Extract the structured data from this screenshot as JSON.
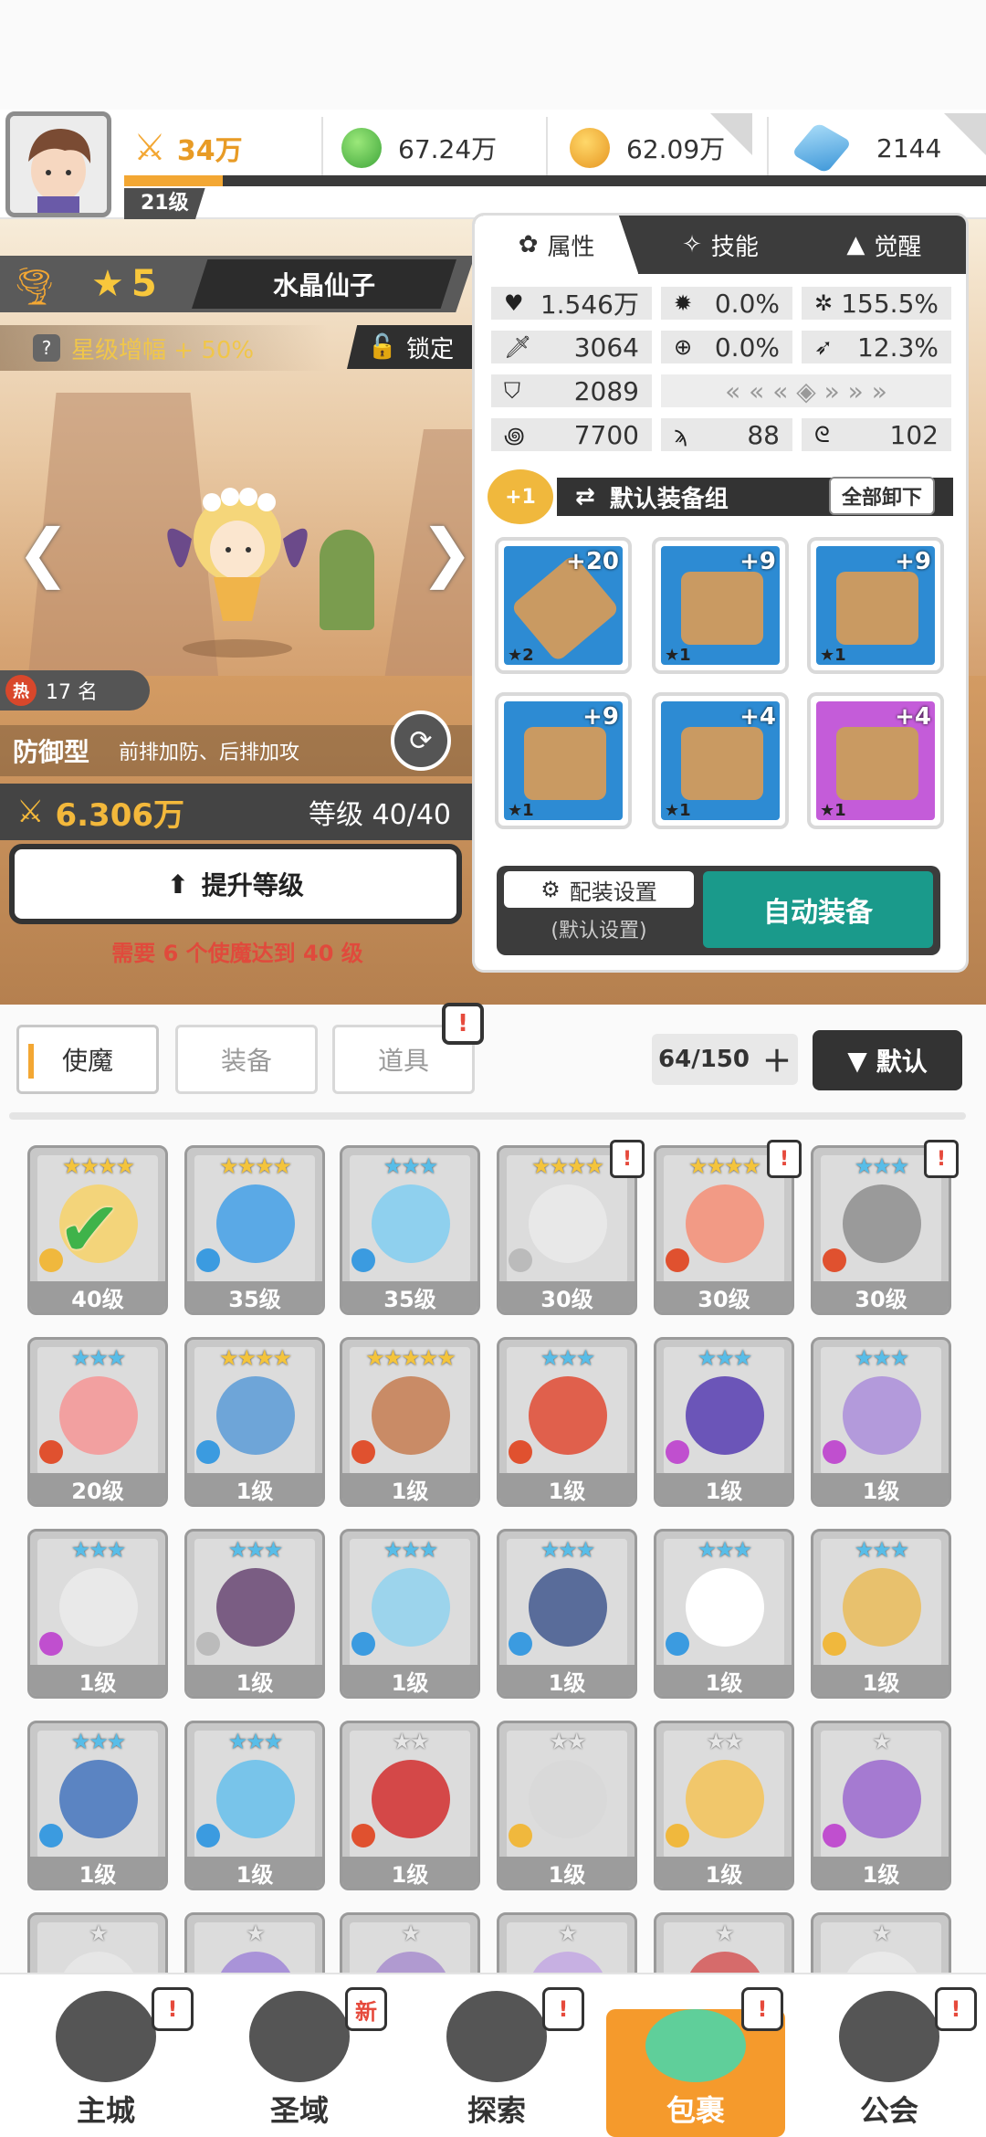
{
  "player": {
    "level": "21级",
    "power": "34万",
    "res_green": "67.24万",
    "res_gold": "62.09万",
    "res_gem": "2144"
  },
  "hero": {
    "stars": "5",
    "name": "水晶仙子",
    "boost": "星级增幅 + 50%",
    "lock": "锁定",
    "rank": "17 名",
    "hot": "热",
    "role": "防御型",
    "role_desc": "前排加防、后排加攻",
    "power": "6.306万",
    "level": "等级 40/40",
    "upgrade": "提升等级",
    "requirement": "需要 6 个使魔达到 40 级"
  },
  "panel": {
    "tabs": [
      "属性",
      "技能",
      "觉醒"
    ],
    "stats": {
      "hp": "1.546万",
      "crit": "0.0%",
      "crit_dmg": "155.5%",
      "atk": "3064",
      "acc": "0.0%",
      "speed_pct": "12.3%",
      "def": "2089",
      "s1": "7700",
      "s2": "88",
      "s3": "102"
    },
    "equip_group": "默认装备组",
    "plus_one": "+1",
    "unequip_all": "全部卸下",
    "equips": [
      {
        "plus": "+20",
        "star": "★2",
        "color": "blue",
        "icon": "sword-icon"
      },
      {
        "plus": "+9",
        "star": "★1",
        "color": "blue",
        "icon": "helmet-icon"
      },
      {
        "plus": "+9",
        "star": "★1",
        "color": "blue",
        "icon": "armor-icon"
      },
      {
        "plus": "+9",
        "star": "★1",
        "color": "blue",
        "icon": "belt-icon"
      },
      {
        "plus": "+4",
        "star": "★1",
        "color": "blue",
        "icon": "necklace-icon"
      },
      {
        "plus": "+4",
        "star": "★1",
        "color": "purple",
        "icon": "boots-icon"
      }
    ],
    "config": "配装设置",
    "config_sub": "(默认设置)",
    "auto_equip": "自动装备"
  },
  "bag": {
    "tabs": [
      "使魔",
      "装备",
      "道具"
    ],
    "count": "64/150",
    "sort": "默认",
    "alert": "!",
    "cards": [
      {
        "stars": "★★★★",
        "tier": "gold",
        "lvl": "40级",
        "elem": "#f0b83d",
        "alert": false,
        "check": true,
        "face": "#f3d47a"
      },
      {
        "stars": "★★★★",
        "tier": "gold",
        "lvl": "35级",
        "elem": "#3b9be0",
        "alert": false,
        "check": false,
        "face": "#5aa9e6"
      },
      {
        "stars": "★★★",
        "tier": "blue",
        "lvl": "35级",
        "elem": "#3b9be0",
        "alert": false,
        "check": false,
        "face": "#8fd0ee"
      },
      {
        "stars": "★★★★",
        "tier": "gold",
        "lvl": "30级",
        "elem": "#bbbbbb",
        "alert": true,
        "check": false,
        "face": "#e8e8e8"
      },
      {
        "stars": "★★★★",
        "tier": "gold",
        "lvl": "30级",
        "elem": "#e0512f",
        "alert": true,
        "check": false,
        "face": "#f29a85"
      },
      {
        "stars": "★★★",
        "tier": "blue",
        "lvl": "30级",
        "elem": "#e0512f",
        "alert": true,
        "check": false,
        "face": "#9a9a9a"
      },
      {
        "stars": "★★★",
        "tier": "blue",
        "lvl": "20级",
        "elem": "#e0512f",
        "alert": false,
        "check": false,
        "face": "#f2a0a0"
      },
      {
        "stars": "★★★★",
        "tier": "gold",
        "lvl": "1级",
        "elem": "#3b9be0",
        "alert": false,
        "check": false,
        "face": "#6ea5d8"
      },
      {
        "stars": "★★★★★",
        "tier": "gold",
        "lvl": "1级",
        "elem": "#e0512f",
        "alert": false,
        "check": false,
        "face": "#c98b66"
      },
      {
        "stars": "★★★",
        "tier": "blue",
        "lvl": "1级",
        "elem": "#e0512f",
        "alert": false,
        "check": false,
        "face": "#e0604c"
      },
      {
        "stars": "★★★",
        "tier": "blue",
        "lvl": "1级",
        "elem": "#c04fcf",
        "alert": false,
        "check": false,
        "face": "#6b55b8"
      },
      {
        "stars": "★★★",
        "tier": "blue",
        "lvl": "1级",
        "elem": "#c04fcf",
        "alert": false,
        "check": false,
        "face": "#b39adb"
      },
      {
        "stars": "★★★",
        "tier": "blue",
        "lvl": "1级",
        "elem": "#c04fcf",
        "alert": false,
        "check": false,
        "face": "#e9e9e9"
      },
      {
        "stars": "★★★",
        "tier": "blue",
        "lvl": "1级",
        "elem": "#bbbbbb",
        "alert": false,
        "check": false,
        "face": "#7a5d83"
      },
      {
        "stars": "★★★",
        "tier": "blue",
        "lvl": "1级",
        "elem": "#3b9be0",
        "alert": false,
        "check": false,
        "face": "#9cd4ec"
      },
      {
        "stars": "★★★",
        "tier": "blue",
        "lvl": "1级",
        "elem": "#3b9be0",
        "alert": false,
        "check": false,
        "face": "#596c9a"
      },
      {
        "stars": "★★★",
        "tier": "blue",
        "lvl": "1级",
        "elem": "#3b9be0",
        "alert": false,
        "check": false,
        "face": "#ffffff"
      },
      {
        "stars": "★★★",
        "tier": "blue",
        "lvl": "1级",
        "elem": "#f0b83d",
        "alert": false,
        "check": false,
        "face": "#e8c16d"
      },
      {
        "stars": "★★★",
        "tier": "blue",
        "lvl": "1级",
        "elem": "#3b9be0",
        "alert": false,
        "check": false,
        "face": "#5b84c2"
      },
      {
        "stars": "★★★",
        "tier": "blue",
        "lvl": "1级",
        "elem": "#3b9be0",
        "alert": false,
        "check": false,
        "face": "#78c4ea"
      },
      {
        "stars": "★★",
        "tier": "silver",
        "lvl": "1级",
        "elem": "#e0512f",
        "alert": false,
        "check": false,
        "face": "#d44848"
      },
      {
        "stars": "★★",
        "tier": "silver",
        "lvl": "1级",
        "elem": "#f0b83d",
        "alert": false,
        "check": false,
        "face": "#d9d9d9"
      },
      {
        "stars": "★★",
        "tier": "silver",
        "lvl": "1级",
        "elem": "#f0b83d",
        "alert": false,
        "check": false,
        "face": "#f1c76b"
      },
      {
        "stars": "★",
        "tier": "silver",
        "lvl": "1级",
        "elem": "#c04fcf",
        "alert": false,
        "check": false,
        "face": "#a57ad1"
      },
      {
        "stars": "★",
        "tier": "silver",
        "lvl": "",
        "elem": "",
        "alert": false,
        "check": false,
        "face": "#e6e6e6"
      },
      {
        "stars": "★",
        "tier": "silver",
        "lvl": "",
        "elem": "",
        "alert": false,
        "check": false,
        "face": "#a993d8"
      },
      {
        "stars": "★",
        "tier": "silver",
        "lvl": "",
        "elem": "",
        "alert": false,
        "check": false,
        "face": "#b09ad0"
      },
      {
        "stars": "★",
        "tier": "silver",
        "lvl": "",
        "elem": "",
        "alert": false,
        "check": false,
        "face": "#c7b0e2"
      },
      {
        "stars": "★",
        "tier": "silver",
        "lvl": "",
        "elem": "",
        "alert": false,
        "check": false,
        "face": "#d66b6b"
      },
      {
        "stars": "★",
        "tier": "silver",
        "lvl": "",
        "elem": "",
        "alert": false,
        "check": false,
        "face": "#e9e9e9"
      }
    ]
  },
  "nav": {
    "items": [
      {
        "label": "主城",
        "badge": "!",
        "icon": "castle-icon"
      },
      {
        "label": "圣域",
        "badge": "新",
        "icon": "portal-icon"
      },
      {
        "label": "探索",
        "badge": "!",
        "icon": "sword-stone-icon"
      },
      {
        "label": "包裹",
        "badge": "!",
        "icon": "bag-icon",
        "active": true
      },
      {
        "label": "公会",
        "badge": "!",
        "icon": "guild-icon"
      }
    ]
  }
}
